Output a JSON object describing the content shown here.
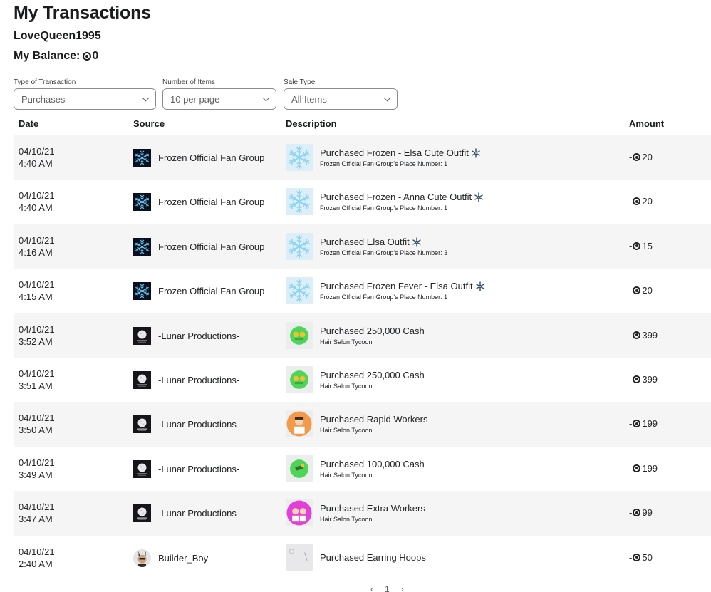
{
  "page": {
    "title": "My Transactions",
    "username": "LoveQueen1995",
    "balance_label": "My Balance:",
    "balance_value": "0"
  },
  "filters": [
    {
      "label": "Type of Transaction",
      "value": "Purchases"
    },
    {
      "label": "Number of Items",
      "value": "10 per page"
    },
    {
      "label": "Sale Type",
      "value": "All Items"
    }
  ],
  "table": {
    "headers": {
      "date": "Date",
      "source": "Source",
      "description": "Description",
      "amount": "Amount"
    },
    "rows": [
      {
        "date": "04/10/21",
        "time": "4:40 AM",
        "source": "Frozen Official Fan Group",
        "source_icon": "snowflake-group-icon",
        "item": "Purchased Frozen - Elsa Cute Outfit",
        "sub": "Frozen Official Fan Group's Place Number: 1",
        "premium": true,
        "amount": "20",
        "thumb": "snowflake"
      },
      {
        "date": "04/10/21",
        "time": "4:40 AM",
        "source": "Frozen Official Fan Group",
        "source_icon": "snowflake-group-icon",
        "item": "Purchased Frozen - Anna Cute Outfit",
        "sub": "Frozen Official Fan Group's Place Number: 1",
        "premium": true,
        "amount": "20",
        "thumb": "snowflake"
      },
      {
        "date": "04/10/21",
        "time": "4:16 AM",
        "source": "Frozen Official Fan Group",
        "source_icon": "snowflake-group-icon",
        "item": "Purchased Elsa Outfit",
        "sub": "Frozen Official Fan Group's Place Number: 3",
        "premium": true,
        "amount": "15",
        "thumb": "snowflake"
      },
      {
        "date": "04/10/21",
        "time": "4:15 AM",
        "source": "Frozen Official Fan Group",
        "source_icon": "snowflake-group-icon",
        "item": "Purchased Frozen Fever - Elsa Outfit",
        "sub": "Frozen Official Fan Group's Place Number: 1",
        "premium": true,
        "amount": "20",
        "thumb": "snowflake"
      },
      {
        "date": "04/10/21",
        "time": "3:52 AM",
        "source": "-Lunar Productions-",
        "source_icon": "moon-group-icon",
        "item": "Purchased 250,000 Cash",
        "sub": "Hair Salon Tycoon",
        "premium": false,
        "amount": "399",
        "thumb": "cash"
      },
      {
        "date": "04/10/21",
        "time": "3:51 AM",
        "source": "-Lunar Productions-",
        "source_icon": "moon-group-icon",
        "item": "Purchased 250,000 Cash",
        "sub": "Hair Salon Tycoon",
        "premium": false,
        "amount": "399",
        "thumb": "cash"
      },
      {
        "date": "04/10/21",
        "time": "3:50 AM",
        "source": "-Lunar Productions-",
        "source_icon": "moon-group-icon",
        "item": "Purchased Rapid Workers",
        "sub": "Hair Salon Tycoon",
        "premium": false,
        "amount": "199",
        "thumb": "workers-orange"
      },
      {
        "date": "04/10/21",
        "time": "3:49 AM",
        "source": "-Lunar Productions-",
        "source_icon": "moon-group-icon",
        "item": "Purchased 100,000 Cash",
        "sub": "Hair Salon Tycoon",
        "premium": false,
        "amount": "199",
        "thumb": "cash-small"
      },
      {
        "date": "04/10/21",
        "time": "3:47 AM",
        "source": "-Lunar Productions-",
        "source_icon": "moon-group-icon",
        "item": "Purchased Extra Workers",
        "sub": "Hair Salon Tycoon",
        "premium": false,
        "amount": "99",
        "thumb": "workers-pink"
      },
      {
        "date": "04/10/21",
        "time": "2:40 AM",
        "source": "Builder_Boy",
        "source_icon": "user-avatar-icon",
        "item": "Purchased Earring Hoops",
        "sub": "",
        "premium": false,
        "amount": "50",
        "thumb": "earring"
      }
    ]
  },
  "amount_prefix": "-",
  "pager": {
    "prev": "‹",
    "page": "1",
    "next": "›"
  }
}
